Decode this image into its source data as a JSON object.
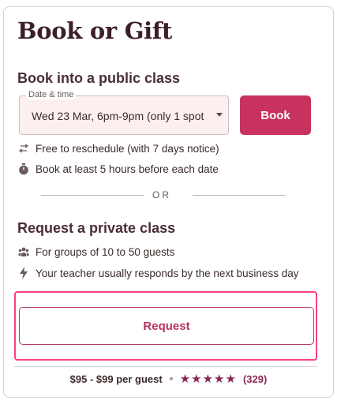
{
  "card": {
    "title": "Book or Gift"
  },
  "public_class": {
    "heading": "Book into a public class",
    "date_field": {
      "label": "Date & time",
      "value": "Wed 23 Mar, 6pm-9pm  (only 1 spot"
    },
    "book_label": "Book",
    "info": [
      {
        "icon": "swap-arrows-icon",
        "text": "Free to reschedule (with 7 days notice)"
      },
      {
        "icon": "stopwatch-icon",
        "text": "Book at least 5 hours before each date"
      }
    ]
  },
  "separator": {
    "label": "OR"
  },
  "private_class": {
    "heading": "Request a private class",
    "info": [
      {
        "icon": "group-icon",
        "text": "For groups of 10 to 50 guests"
      },
      {
        "icon": "lightning-icon",
        "text": "Your teacher usually responds by the next business day"
      }
    ],
    "request_label": "Request"
  },
  "footer": {
    "price": "$95 - $99 per guest",
    "rating_stars": 5,
    "stars_text": "★★★★★",
    "review_count": "(329)"
  },
  "colors": {
    "brand": "#c7325f",
    "star": "#8b2453",
    "highlight": "#ff3f86"
  }
}
